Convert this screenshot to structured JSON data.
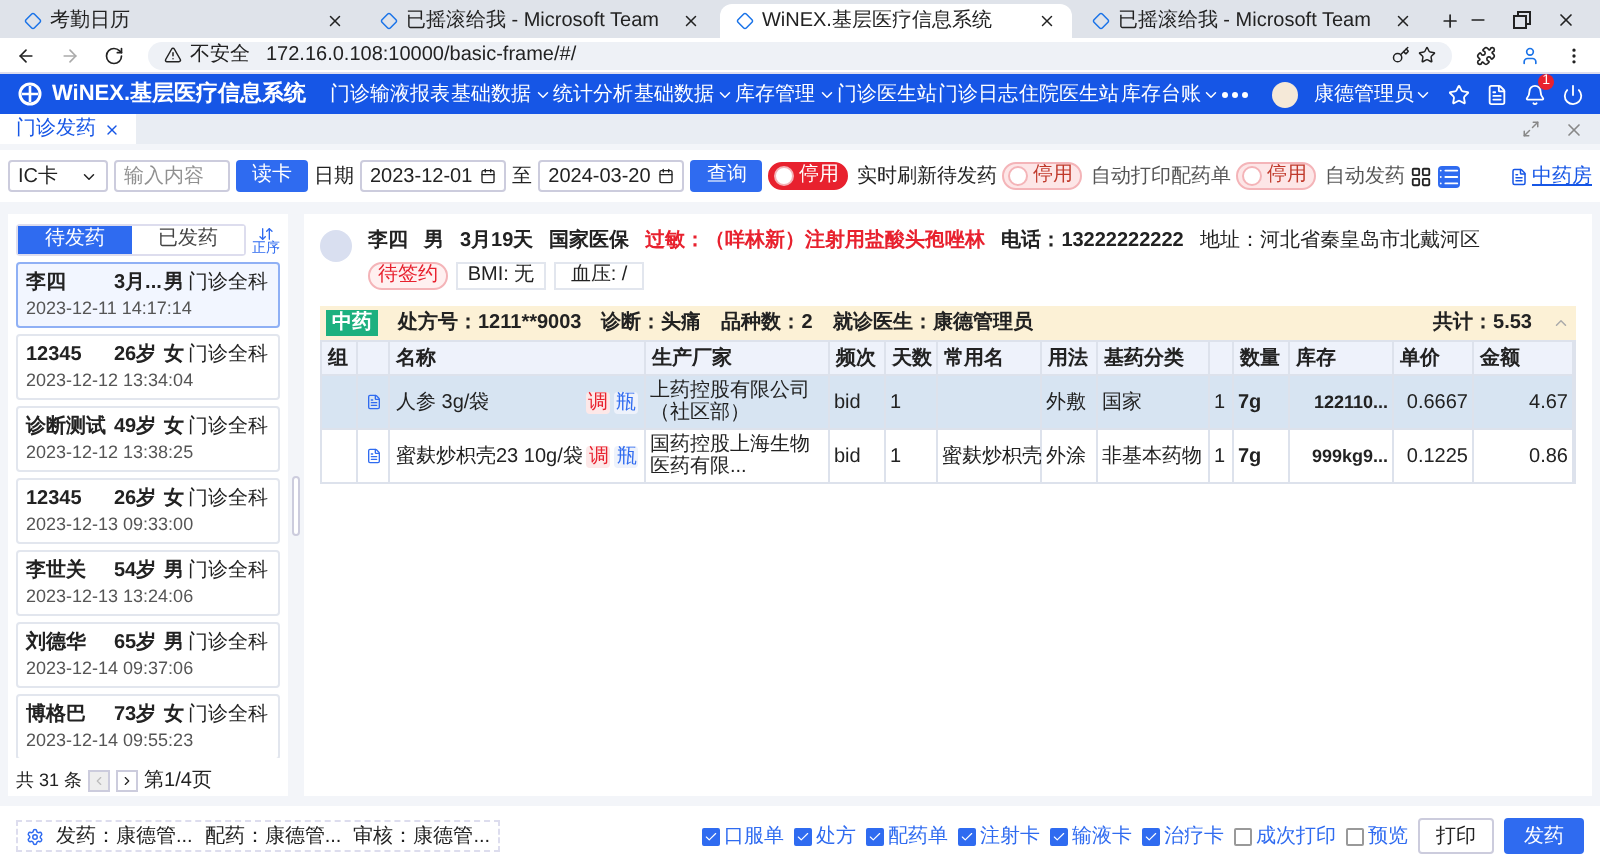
{
  "browser": {
    "tabs": [
      {
        "title": "考勤日历",
        "selected": false
      },
      {
        "title": "已摇滚给我 - Microsoft Team",
        "selected": false
      },
      {
        "title": "WiNEX.基层医疗信息系统",
        "selected": true
      },
      {
        "title": "已摇滚给我 - Microsoft Team",
        "selected": false
      }
    ],
    "security": "不安全",
    "url": "172.16.0.108:10000/basic-frame/#/"
  },
  "app": {
    "logo": "WiNEX.基层医疗信息系统",
    "nav": [
      {
        "label": "门诊输液报表",
        "dropdown": false
      },
      {
        "label": "基础数据",
        "dropdown": true
      },
      {
        "label": "统计分析",
        "dropdown": false
      },
      {
        "label": "基础数据",
        "dropdown": true
      },
      {
        "label": "库存管理",
        "dropdown": true
      },
      {
        "label": "门诊医生站",
        "dropdown": false
      },
      {
        "label": "门诊日志",
        "dropdown": false
      },
      {
        "label": "住院医生站",
        "dropdown": false
      },
      {
        "label": "库存台账",
        "dropdown": true
      }
    ],
    "user": "康德管理员",
    "notification_count": "1"
  },
  "page_tabs": [
    {
      "label": "门诊发药",
      "selected": true
    }
  ],
  "toolbar": {
    "card_type": "IC卡",
    "search_placeholder": "输入内容",
    "read_button": "读卡",
    "date_label": "日期",
    "date_from": "2023-12-01",
    "date_sep": "至",
    "date_to": "2024-03-20",
    "query_button": "查询",
    "toggles": [
      {
        "badge": "停用",
        "label": "实时刷新待发药",
        "on": false,
        "disabled": false
      },
      {
        "badge": "停用",
        "label": "自动打印配药单",
        "on": false,
        "disabled": true
      },
      {
        "badge": "停用",
        "label": "自动发药",
        "on": false,
        "disabled": true
      }
    ],
    "views": [
      {
        "kind": "grid",
        "selected": false
      },
      {
        "kind": "list",
        "selected": true
      }
    ],
    "pharmacy": "中药房"
  },
  "queue": {
    "tabs": [
      {
        "label": "待发药",
        "selected": true
      },
      {
        "label": "已发药",
        "selected": false
      }
    ],
    "sort_label": "正序",
    "patients": [
      {
        "name": "李四",
        "age": "3月...",
        "sex": "男",
        "dept": "门诊全科",
        "time": "2023-12-11 14:17:14",
        "selected": true
      },
      {
        "name": "12345",
        "age": "26岁",
        "sex": "女",
        "dept": "门诊全科",
        "time": "2023-12-12 13:34:04",
        "selected": false
      },
      {
        "name": "诊断测试",
        "age": "49岁",
        "sex": "女",
        "dept": "门诊全科",
        "time": "2023-12-12 13:38:25",
        "selected": false
      },
      {
        "name": "12345",
        "age": "26岁",
        "sex": "女",
        "dept": "门诊全科",
        "time": "2023-12-13 09:33:00",
        "selected": false
      },
      {
        "name": "李世关",
        "age": "54岁",
        "sex": "男",
        "dept": "门诊全科",
        "time": "2023-12-13 13:24:06",
        "selected": false
      },
      {
        "name": "刘德华",
        "age": "65岁",
        "sex": "男",
        "dept": "门诊全科",
        "time": "2023-12-14 09:37:06",
        "selected": false
      },
      {
        "name": "博格巴",
        "age": "73岁",
        "sex": "女",
        "dept": "门诊全科",
        "time": "2023-12-14 09:55:23",
        "selected": false
      }
    ],
    "total": "共 31 条",
    "prev_disabled": true,
    "page": "第1/4页"
  },
  "patient": {
    "name": "李四",
    "sex": "男",
    "age": "3月19天",
    "insurance": "国家医保",
    "allergy": "过敏：（咩林新）注射用盐酸头孢唑林",
    "phone": "电话：13222222222",
    "address": "地址：河北省秦皇岛市北戴河区",
    "status": "待签约",
    "bmi": "BMI: 无",
    "blood_pressure": "血压: /"
  },
  "prescription": {
    "type": "中药",
    "number": "处方号：1211**9003",
    "diagnosis": "诊断：头痛",
    "count": "品种数：2",
    "doctor": "就诊医生：康德管理员",
    "total": "共计：5.53",
    "expanded": true,
    "columns": [
      "组",
      "",
      "名称",
      "生产厂家",
      "频次",
      "天数",
      "常用名",
      "用法",
      "基药分类",
      "",
      "数量",
      "库存",
      "单价",
      "金额"
    ],
    "rows": [
      {
        "selected": true,
        "tags": [
          "调",
          "瓶"
        ],
        "cells": [
          "",
          "",
          "人参 3g/袋",
          "上药控股有限公司（社区部）",
          "bid",
          "1",
          "",
          "外敷",
          "国家",
          "1",
          "7g",
          "122110...",
          "0.6667",
          "4.67"
        ]
      },
      {
        "selected": false,
        "tags": [
          "调",
          "瓶"
        ],
        "cells": [
          "",
          "",
          "蜜麸炒枳壳23 10g/袋",
          "国药控股上海生物医药有限...",
          "bid",
          "1",
          "蜜麸炒枳壳",
          "外涂",
          "非基本药物",
          "1",
          "7g",
          "999kg9...",
          "0.1225",
          "0.86"
        ]
      }
    ]
  },
  "footer": {
    "staff": [
      "发药：康德管...",
      "配药：康德管...",
      "审核：康德管..."
    ],
    "options": [
      {
        "label": "口服单",
        "checked": true
      },
      {
        "label": "处方",
        "checked": true
      },
      {
        "label": "配药单",
        "checked": true
      },
      {
        "label": "注射卡",
        "checked": true
      },
      {
        "label": "输液卡",
        "checked": true
      },
      {
        "label": "治疗卡",
        "checked": true
      },
      {
        "label": "成次打印",
        "checked": false
      },
      {
        "label": "预览",
        "checked": false
      }
    ],
    "print_button": "打印",
    "dispense_button": "发药"
  }
}
